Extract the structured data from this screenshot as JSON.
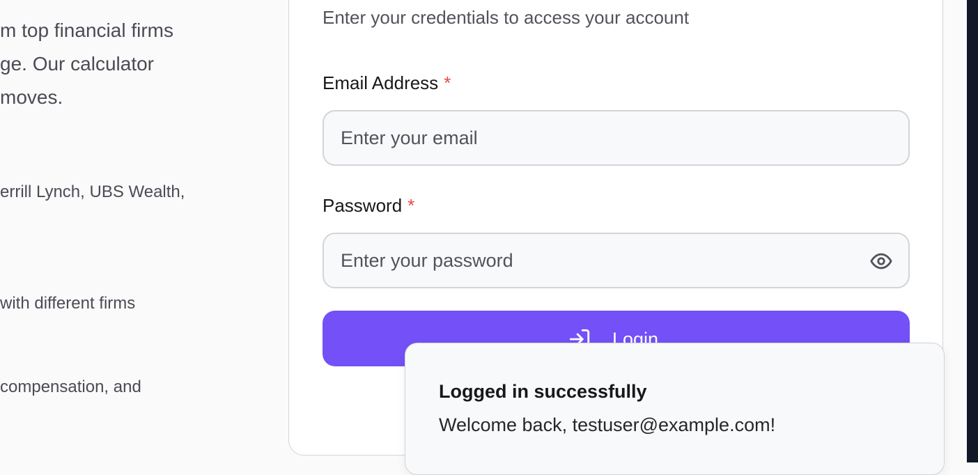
{
  "left": {
    "hero_lines": [
      "m top financial firms",
      "ge. Our calculator",
      "moves."
    ],
    "features": [
      "errill Lynch, UBS Wealth,",
      "with different firms",
      "compensation, and"
    ]
  },
  "card": {
    "subtitle": "Enter your credentials to access your account",
    "email": {
      "label": "Email Address",
      "required": "*",
      "placeholder": "Enter your email",
      "value": ""
    },
    "password": {
      "label": "Password",
      "required": "*",
      "placeholder": "Enter your password",
      "value": ""
    },
    "login_label": "Login",
    "icons": {
      "show_password": "eye-icon",
      "login": "log-in-icon"
    }
  },
  "toast": {
    "title": "Logged in successfully",
    "message": "Welcome back, testuser@example.com!"
  },
  "colors": {
    "primary": "#7350f7",
    "required": "#ef4444",
    "border": "#d4d4d8"
  }
}
